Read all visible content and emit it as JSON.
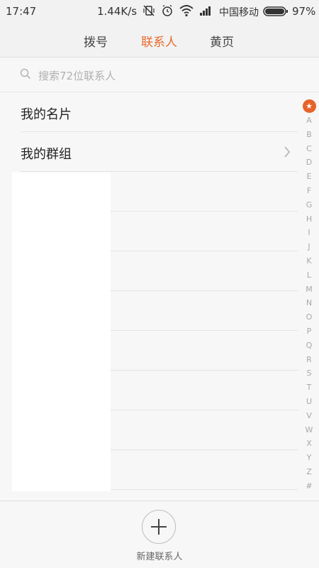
{
  "status_bar": {
    "time": "17:47",
    "net_speed": "1.44K/s",
    "carrier": "中国移动",
    "battery": "97%",
    "icons": [
      "vibrate-off-icon",
      "alarm-icon",
      "wifi-icon",
      "signal-icon",
      "battery-icon"
    ]
  },
  "tabs": [
    {
      "label": "拨号",
      "active": false
    },
    {
      "label": "联系人",
      "active": true
    },
    {
      "label": "黄页",
      "active": false
    }
  ],
  "search": {
    "placeholder": "搜索72位联系人",
    "icon": "search-icon"
  },
  "list": {
    "my_card": "我的名片",
    "my_groups": "我的群组"
  },
  "index": {
    "star": "★",
    "letters": [
      "A",
      "B",
      "C",
      "D",
      "E",
      "F",
      "G",
      "H",
      "I",
      "J",
      "K",
      "L",
      "M",
      "N",
      "O",
      "P",
      "Q",
      "R",
      "S",
      "T",
      "U",
      "V",
      "W",
      "X",
      "Y",
      "Z",
      "#"
    ]
  },
  "bottom": {
    "add_label": "新建联系人",
    "add_icon": "plus-icon"
  },
  "colors": {
    "accent": "#e66a2c",
    "background": "#f7f7f7"
  }
}
